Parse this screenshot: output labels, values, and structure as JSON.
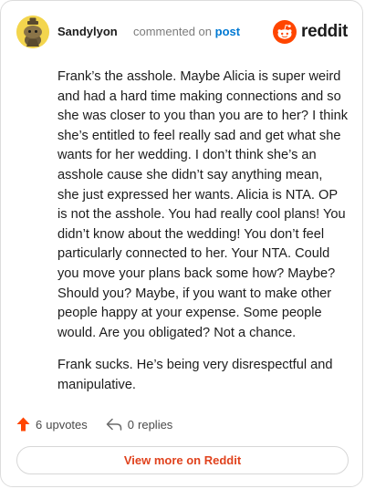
{
  "comment": {
    "username": "Sandylyon",
    "action_text": "commented on",
    "post_link": "post",
    "paragraphs": [
      "Frank’s the asshole. Maybe Alicia is super weird and had a hard time making connections and so she was closer to you than you are to her? I think she’s entitled to feel really sad and get what she wants for her wedding. I don’t think she’s an asshole cause she didn’t say anything mean, she just expressed her wants. Alicia is NTA. OP is not the asshole. You had really cool plans! You didn’t know about the wedding! You don’t feel particularly connected to her. Your NTA. Could you move your plans back some how? Maybe? Should you? Maybe, if you want to make other people happy at your expense. Some people would. Are you obligated? Not a chance.",
      "Frank sucks. He’s being very disrespectful and manipulative."
    ]
  },
  "brand": {
    "name": "reddit",
    "color": "#ff4500",
    "icon": "reddit-logo-icon"
  },
  "actions": {
    "upvotes_count": "6",
    "upvotes_label": "upvotes",
    "replies_count": "0",
    "replies_label": "replies",
    "upvote_icon": "upvote-arrow-icon",
    "reply_icon": "reply-arrow-icon",
    "upvote_color": "#ff4500"
  },
  "footer": {
    "view_more_label": "View more on Reddit",
    "link_color": "#e0421d"
  },
  "colors": {
    "avatar_bg": "#f3d54d",
    "post_link": "#0079d3",
    "text": "#1c1c1c",
    "muted": "#7c7c7c"
  }
}
